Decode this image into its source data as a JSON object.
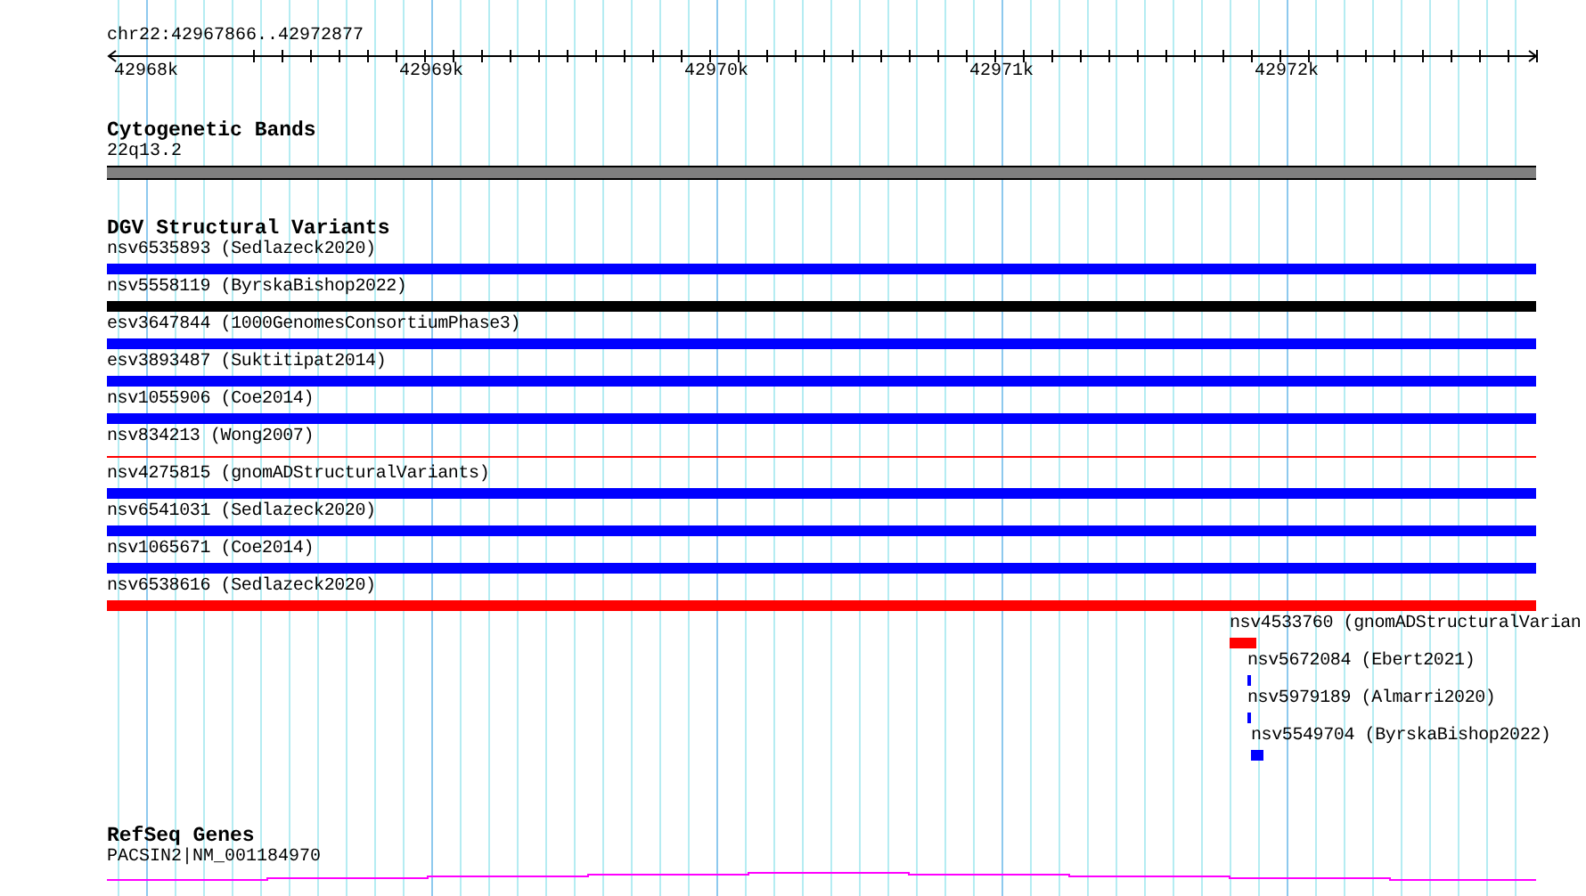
{
  "ruler": {
    "location": "chr22:42967866..42972877",
    "ticks": [
      "42968k",
      "42969k",
      "42970k",
      "42971k",
      "42972k"
    ]
  },
  "tracks": [
    {
      "title": "Cytogenetic Bands",
      "kind": "bands",
      "features": [
        {
          "label": "22q13.2"
        }
      ]
    },
    {
      "title": "DGV Structural Variants",
      "kind": "variants",
      "features": [
        {
          "label": "nsv6535893 (Sedlazeck2020)",
          "color": "#0000ff",
          "kind": "bar"
        },
        {
          "label": "nsv5558119 (ByrskaBishop2022)",
          "color": "#000000",
          "kind": "bar"
        },
        {
          "label": "esv3647844 (1000GenomesConsortiumPhase3)",
          "color": "#0000ff",
          "kind": "bar"
        },
        {
          "label": "esv3893487 (Suktitipat2014)",
          "color": "#0000ff",
          "kind": "bar"
        },
        {
          "label": "nsv1055906 (Coe2014)",
          "color": "#0000ff",
          "kind": "bar"
        },
        {
          "label": "nsv834213 (Wong2007)",
          "color": "#ff0000",
          "kind": "line"
        },
        {
          "label": "nsv4275815 (gnomADStructuralVariants)",
          "color": "#0000ff",
          "kind": "bar"
        },
        {
          "label": "nsv6541031 (Sedlazeck2020)",
          "color": "#0000ff",
          "kind": "bar"
        },
        {
          "label": "nsv1065671 (Coe2014)",
          "color": "#0000ff",
          "kind": "bar"
        },
        {
          "label": "nsv6538616 (Sedlazeck2020)",
          "color": "#ff0000",
          "kind": "bar"
        },
        {
          "label": "nsv4533760 (gnomADStructuralVarian",
          "color": "#ff0000",
          "kind": "bar"
        },
        {
          "label": "nsv5672084 (Ebert2021)",
          "color": "#0000ff",
          "kind": "bar"
        },
        {
          "label": "nsv5979189 (Almarri2020)",
          "color": "#0000ff",
          "kind": "bar"
        },
        {
          "label": "nsv5549704 (ByrskaBishop2022)",
          "color": "#0000ff",
          "kind": "bar"
        }
      ]
    },
    {
      "title": "RefSeq Genes",
      "kind": "genes",
      "features": [
        {
          "label": "PACSIN2|NM_001184970"
        }
      ]
    }
  ]
}
